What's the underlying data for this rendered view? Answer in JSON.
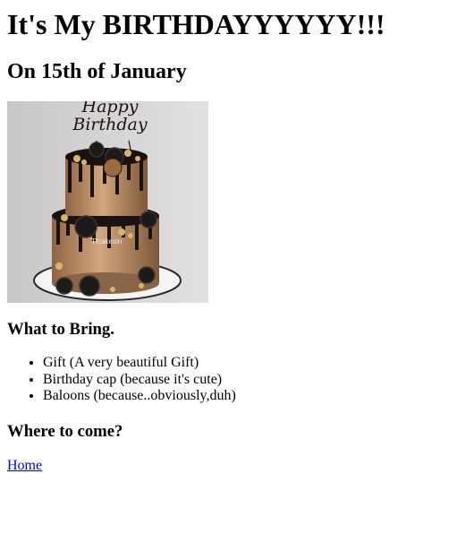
{
  "page": {
    "heading": "It's My BIRTHDAYYYYYY!!!",
    "subheading": "On 15th of January"
  },
  "image": {
    "topper_text": "Happy Birthday",
    "watermark": "Tfcakesin",
    "icon": "birthday-cake-image"
  },
  "bring": {
    "title": "What to Bring.",
    "items": [
      "Gift (A very beautiful Gift)",
      "Birthday cap (because it's cute)",
      "Baloons (because..obviously,duh)"
    ]
  },
  "where": {
    "title": "Where to come?"
  },
  "links": {
    "home": "Home"
  },
  "colors": {
    "link": "#0000ee",
    "background": "#ffffff",
    "cake_gold": "#b9895b",
    "drip": "#1a1210"
  }
}
